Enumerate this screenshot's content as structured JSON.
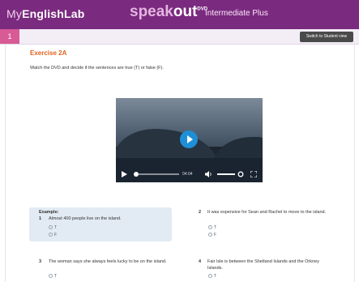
{
  "header": {
    "brand_prefix": "My",
    "brand_main": "EnglishLab",
    "product_speak": "speak",
    "product_out": "out",
    "product_badge": "DVD",
    "level": "Intermediate Plus"
  },
  "subbar": {
    "page_number": "1",
    "switch_button": "Switch to Student view"
  },
  "exercise": {
    "title": "Exercise 2A",
    "instructions": "Watch the DVD and decide if the sentences are true (T) or false (F).",
    "video": {
      "time": "04:04"
    },
    "example_label": "Example:",
    "questions": [
      {
        "num": "1",
        "text": "Almost 400 people live on the island.",
        "options": [
          "T",
          "F"
        ]
      },
      {
        "num": "2",
        "text": "It was expensive for Sean and Rachel to move to the island.",
        "options": [
          "T",
          "F"
        ]
      },
      {
        "num": "3",
        "text": "The woman says she always feels lucky to be on the island.",
        "options": [
          "T"
        ]
      },
      {
        "num": "4",
        "text": "Fair Isle is between the Shetland Islands and the Orkney Islands.",
        "options": [
          "T"
        ]
      }
    ]
  }
}
